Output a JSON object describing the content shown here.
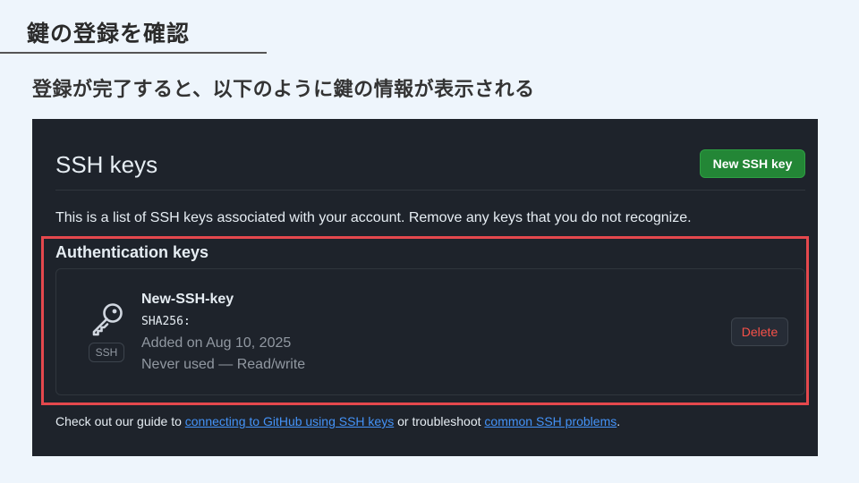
{
  "slide": {
    "title": "鍵の登録を確認",
    "subtitle": "登録が完了すると、以下のように鍵の情報が表示される"
  },
  "panel": {
    "heading": "SSH keys",
    "new_key_button": "New SSH key",
    "description": "This is a list of SSH keys associated with your account. Remove any keys that you do not recognize.",
    "auth_heading": "Authentication keys",
    "key": {
      "icon": "key-icon",
      "badge": "SSH",
      "name": "New-SSH-key",
      "sha": "SHA256:",
      "added": "Added on Aug 10, 2025",
      "usage": "Never used — Read/write",
      "delete_label": "Delete"
    },
    "footer": {
      "prefix": "Check out our guide to ",
      "link1": "connecting to GitHub using SSH keys",
      "middle": " or troubleshoot ",
      "link2": "common SSH problems",
      "suffix": "."
    }
  },
  "colors": {
    "slide_bg": "#eef5fc",
    "panel_bg": "#1e232b",
    "primary_button": "#238636",
    "danger_text": "#f85149",
    "highlight_border": "#e5484d",
    "link": "#4493f8"
  }
}
